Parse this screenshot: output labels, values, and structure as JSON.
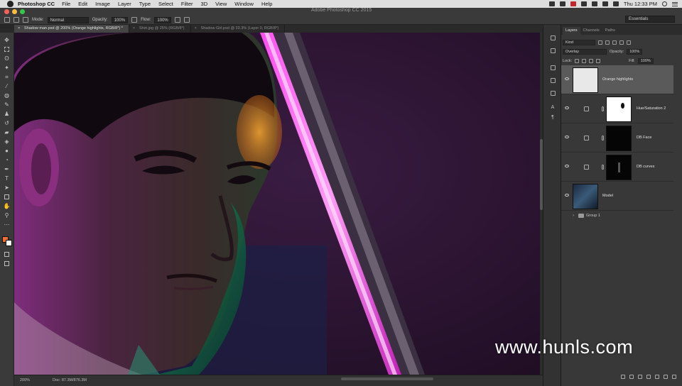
{
  "menubar": {
    "app": "Photoshop CC",
    "items": [
      "File",
      "Edit",
      "Image",
      "Layer",
      "Type",
      "Select",
      "Filter",
      "3D",
      "View",
      "Window",
      "Help"
    ],
    "clock": "Thu 12:33 PM"
  },
  "window": {
    "title": "Adobe Photoshop CC 2015"
  },
  "options_bar": {
    "mode_label": "Mode:",
    "mode_value": "Normal",
    "opacity_label": "Opacity:",
    "opacity_value": "100%",
    "flow_label": "Flow:",
    "flow_value": "100%",
    "workspace": "Essentials"
  },
  "tabs": [
    {
      "label": "Shadow man.psd @ 200% (Orange highlights, RGB/8*) *",
      "active": true
    },
    {
      "label": "Shirt.jpg @ 25% (RGB/8*)",
      "active": false
    },
    {
      "label": "Shadow Girl.psd @ 33.3% (Layer 0, RGB/8*)",
      "active": false
    }
  ],
  "status": {
    "zoom": "200%",
    "doc": "Doc: 87.3M/876.3M"
  },
  "panel": {
    "tabs": [
      "Layers",
      "Channels",
      "Paths"
    ],
    "filter": "Kind",
    "blend_mode": "Overlay",
    "opacity_label": "Opacity:",
    "opacity_value": "100%",
    "lock_label": "Lock:",
    "fill_label": "Fill:",
    "fill_value": "100%"
  },
  "layers": [
    {
      "name": "Orange highlights",
      "selected": true
    },
    {
      "name": "Hue/Saturation 2",
      "selected": false
    },
    {
      "name": "DB Face",
      "selected": false
    },
    {
      "name": "DB curves",
      "selected": false
    },
    {
      "name": "Model",
      "selected": false
    }
  ],
  "group": {
    "name": "Group 1"
  },
  "watermark": "www.hunls.com",
  "colors": {
    "accent": "#f07030",
    "canvas_bg": "#2a1430",
    "panel_bg": "#383838"
  }
}
